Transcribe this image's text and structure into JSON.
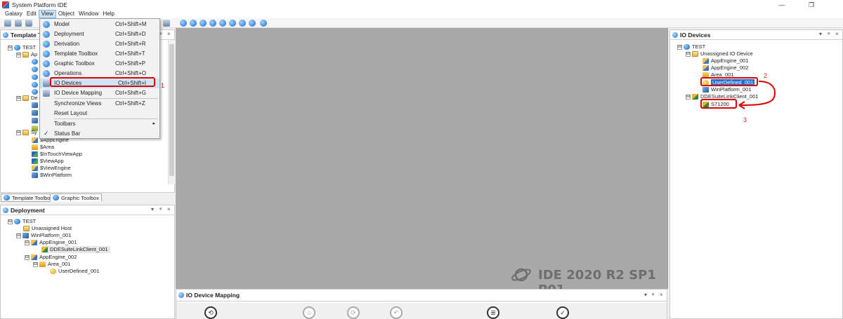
{
  "window": {
    "title": "System Platform IDE",
    "minimize": "—",
    "restore": "❐"
  },
  "menubar": [
    "Galaxy",
    "Edit",
    "View",
    "Object",
    "Window",
    "Help"
  ],
  "view_menu": {
    "items": [
      {
        "label": "Model",
        "shortcut": "Ctrl+Shift+M"
      },
      {
        "label": "Deployment",
        "shortcut": "Ctrl+Shift+D"
      },
      {
        "label": "Derivation",
        "shortcut": "Ctrl+Shift+R"
      },
      {
        "label": "Template Toolbox",
        "shortcut": "Ctrl+Shift+T"
      },
      {
        "label": "Graphic Toolbox",
        "shortcut": "Ctrl+Shift+P"
      },
      {
        "label": "Operations",
        "shortcut": "Ctrl+Shift+O"
      },
      {
        "label": "IO Devices",
        "shortcut": "Ctrl+Shift+I"
      },
      {
        "label": "IO Device Mapping",
        "shortcut": "Ctrl+Shift+G"
      },
      {
        "label": "Synchronize Views",
        "shortcut": "Ctrl+Shift+Z"
      },
      {
        "label": "Reset Layout",
        "shortcut": ""
      },
      {
        "label": "Toolbars",
        "shortcut": "",
        "submenu": "▸"
      },
      {
        "label": "Status Bar",
        "shortcut": "",
        "checked": "✓"
      }
    ]
  },
  "template_toolbox": {
    "title": "Template T",
    "pin": "ᵠ",
    "close": "×",
    "tree": [
      {
        "label": "TEST",
        "exp": "⊟"
      },
      {
        "label": "Ap",
        "exp": "⊟"
      },
      {
        "label": "De",
        "exp": "⊟"
      },
      {
        "label": "Sy",
        "exp": "⊟"
      },
      {
        "label": "$AppEngine"
      },
      {
        "label": "$Area"
      },
      {
        "label": "$InTouchViewApp"
      },
      {
        "label": "$ViewApp"
      },
      {
        "label": "$ViewEngine"
      },
      {
        "label": "$WinPlatform"
      }
    ]
  },
  "tabs": {
    "template": "Template Toolbox",
    "graphic": "Graphic Toolbox"
  },
  "deployment": {
    "title": "Deployment",
    "dropdown": "▾",
    "pin": "ᵠ",
    "close": "×",
    "tree": [
      {
        "label": "TEST",
        "exp": "⊟"
      },
      {
        "label": "Unassigned Host"
      },
      {
        "label": "WinPlatform_001",
        "exp": "⊟"
      },
      {
        "label": "AppEngine_001",
        "exp": "⊟"
      },
      {
        "label": "DDESuiteLinkClient_001"
      },
      {
        "label": "AppEngine_002",
        "exp": "⊟"
      },
      {
        "label": "Area_001",
        "exp": "⊟"
      },
      {
        "label": "UserDefined_001"
      }
    ]
  },
  "io_devices": {
    "title": "IO Devices",
    "dropdown": "▾",
    "pin": "ᵠ",
    "close": "×",
    "tree": [
      {
        "label": "TEST",
        "exp": "⊟"
      },
      {
        "label": "Unassigned IO Device",
        "exp": "⊟"
      },
      {
        "label": "AppEngine_001"
      },
      {
        "label": "AppEngine_002"
      },
      {
        "label": "Area_001"
      },
      {
        "label": "UserDefined_001"
      },
      {
        "label": "WinPlatform_001"
      },
      {
        "label": "DDESuiteLinkClient_001",
        "exp": "⊟"
      },
      {
        "label": "S71200"
      }
    ]
  },
  "watermark": "IDE 2020 R2 SP1 P01",
  "io_mapping": {
    "title": "IO Device Mapping",
    "dropdown": "▾",
    "pin": "ᵠ",
    "close": "×",
    "buttons": [
      "⟲",
      "☺",
      "⟳",
      "↶",
      "≣",
      "✓"
    ]
  },
  "annotations": [
    "1",
    "2",
    "3"
  ],
  "colors": {
    "highlight_red": "#dd0000",
    "selection_blue": "#1e6fd3",
    "workspace_grey": "#a9a9a9"
  }
}
